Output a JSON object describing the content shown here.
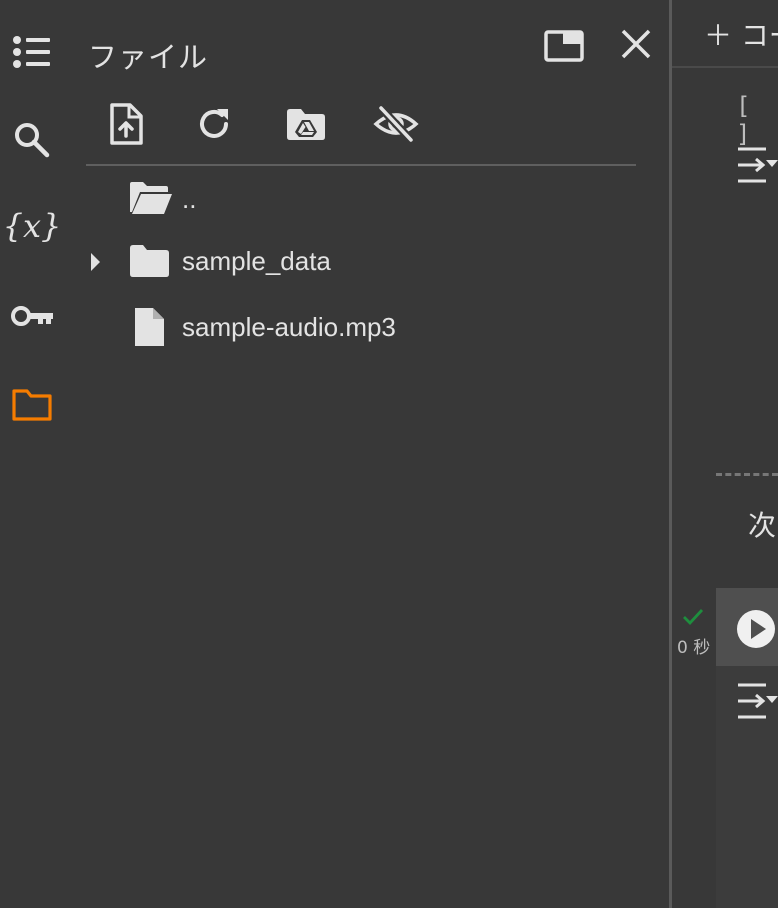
{
  "panel": {
    "title": "ファイル"
  },
  "toolbar": {
    "upload_icon": "upload-file-icon",
    "refresh_icon": "refresh-icon",
    "drive_icon": "mount-drive-icon",
    "hidden_icon": "hide-files-icon"
  },
  "file_tree": {
    "items": [
      {
        "label": "..",
        "type": "parent-folder"
      },
      {
        "label": "sample_data",
        "type": "folder"
      },
      {
        "label": "sample-audio.mp3",
        "type": "file"
      }
    ]
  },
  "notebook": {
    "add_code_label": "＋ コー",
    "empty_cell_bracket": "[ ]",
    "text_cell_fragment": "次",
    "exec_time": "0 秒"
  },
  "colors": {
    "background": "#383838",
    "active_rail": "#f57c00",
    "success": "#1e8e3e"
  }
}
